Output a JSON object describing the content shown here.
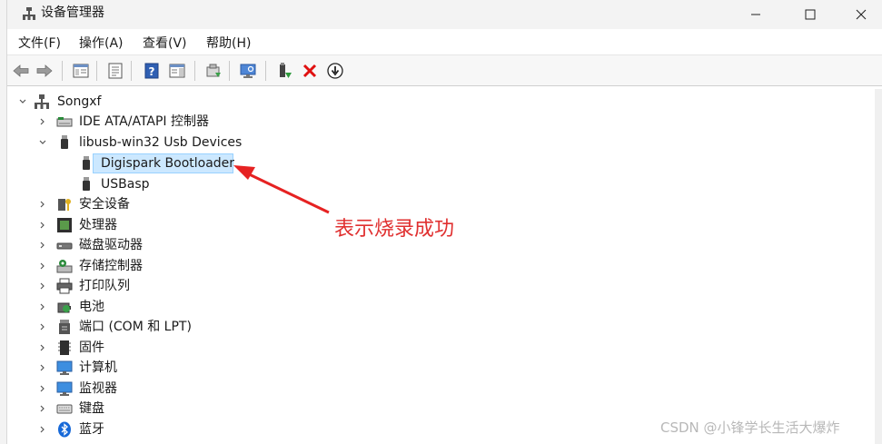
{
  "window": {
    "title": "设备管理器"
  },
  "menu": [
    "文件(F)",
    "操作(A)",
    "查看(V)",
    "帮助(H)"
  ],
  "tree": {
    "root": "Songxf",
    "items": [
      {
        "label": "IDE ATA/ATAPI 控制器",
        "icon": "ide-controller-icon",
        "expanded": false
      },
      {
        "label": "libusb-win32 Usb Devices",
        "icon": "usb-device-icon",
        "expanded": true,
        "children": [
          {
            "label": "Digispark Bootloader",
            "icon": "usb-device-icon",
            "selected": true
          },
          {
            "label": "USBasp",
            "icon": "usb-device-icon"
          }
        ]
      },
      {
        "label": "安全设备",
        "icon": "security-device-icon",
        "expanded": false
      },
      {
        "label": "处理器",
        "icon": "processor-icon",
        "expanded": false
      },
      {
        "label": "磁盘驱动器",
        "icon": "disk-drive-icon",
        "expanded": false
      },
      {
        "label": "存储控制器",
        "icon": "storage-controller-icon",
        "expanded": false
      },
      {
        "label": "打印队列",
        "icon": "printer-icon",
        "expanded": false
      },
      {
        "label": "电池",
        "icon": "battery-icon",
        "expanded": false
      },
      {
        "label": "端口 (COM 和 LPT)",
        "icon": "port-icon",
        "expanded": false
      },
      {
        "label": "固件",
        "icon": "firmware-icon",
        "expanded": false
      },
      {
        "label": "计算机",
        "icon": "computer-icon",
        "expanded": false
      },
      {
        "label": "监视器",
        "icon": "monitor-icon",
        "expanded": false
      },
      {
        "label": "键盘",
        "icon": "keyboard-icon",
        "expanded": false
      },
      {
        "label": "蓝牙",
        "icon": "bluetooth-icon",
        "expanded": false
      }
    ]
  },
  "annotation": {
    "text": "表示烧录成功",
    "color": "#e03030"
  },
  "watermark": "CSDN @小锋学长生活大爆炸",
  "colors": {
    "selection_bg": "#cce8ff",
    "selection_border": "#99d1ff"
  }
}
